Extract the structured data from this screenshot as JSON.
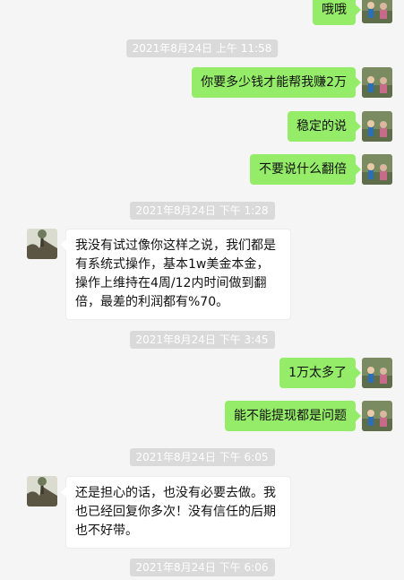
{
  "colors": {
    "my_bubble": "#95ec69",
    "other_bubble": "#ffffff",
    "background": "#f5f5f5",
    "timestamp_bg": "#dadada"
  },
  "messages": {
    "m0": "哦哦",
    "ts1": "2021年8月24日 上午 11:58",
    "m1": "你要多少钱才能帮我赚2万",
    "m2": "稳定的说",
    "m3": "不要说什么翻倍",
    "ts2": "2021年8月24日 下午 1:28",
    "m4": "我没有试过像你这样之说，我们都是有系统式操作，基本1w美金本金，操作上维持在4周/12内时间做到翻倍，最差的利润都有%70。",
    "ts3": "2021年8月24日 下午 3:45",
    "m5": "1万太多了",
    "m6": "能不能提现都是问题",
    "ts4": "2021年8月24日 下午 6:05",
    "m7": "还是担心的话，也没有必要去做。我也已经回复你多次！没有信任的后期也不好带。",
    "ts5": "2021年8月24日 下午 6:06"
  }
}
